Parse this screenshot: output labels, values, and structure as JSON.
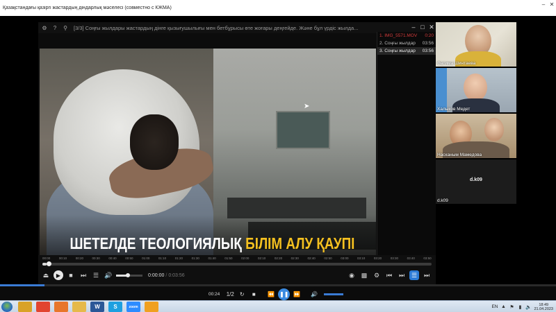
{
  "window": {
    "title": "Қазақстандағы қазіргі жастардың діндарлық мәселесі (совместно с КЖМА)"
  },
  "player": {
    "title": "[3/3] Соңғы жылдары жастардың дінге қызығушылығы мен  бетбұрысы өте жоғары деңгейде. Және бұл үрдіс  жылда...",
    "playlist": [
      {
        "label": "1. IMG_5571.MOV",
        "duration": "0:20",
        "state": "err"
      },
      {
        "label": "2. Соңғы жылдар",
        "duration": "03:56",
        "state": "normal"
      },
      {
        "label": "3. Соңғы жылдар",
        "duration": "03:56",
        "state": "active"
      }
    ],
    "caption": {
      "part1": "ШЕТЕЛДЕ ТЕОЛОГИЯЛЫҚ ",
      "part2": "БІЛІМ АЛУ ҚАУПІ"
    },
    "timeline_ticks": [
      "00:00",
      "00:10",
      "00:20",
      "00:30",
      "00:40",
      "00:50",
      "01:00",
      "01:10",
      "01:20",
      "01:30",
      "01:40",
      "01:50",
      "02:00",
      "02:10",
      "02:20",
      "02:30",
      "02:40",
      "02:50",
      "03:00",
      "03:10",
      "03:20",
      "03:30",
      "03:40",
      "03:50"
    ],
    "progress": 0.01,
    "volume": 0.45,
    "time_current": "0:00:00",
    "time_separator": "/",
    "time_total": "0:03:56"
  },
  "participants": [
    {
      "name": "Фатима Шинтаева"
    },
    {
      "name": "Халыков Медет"
    },
    {
      "name": "Насканым Мамедова"
    },
    {
      "name": "d.k09",
      "center_label": "d.k09"
    }
  ],
  "desktop_player": {
    "time": "00:24",
    "speed": "1/2",
    "progress": 0.08
  },
  "taskbar": {
    "apps": [
      {
        "icon": "explorer-icon",
        "color": "#d9a227"
      },
      {
        "icon": "chrome-icon",
        "color": "#e2442f"
      },
      {
        "icon": "firefox-icon",
        "color": "#e8762b"
      },
      {
        "icon": "folder-icon",
        "color": "#e6b94a"
      },
      {
        "icon": "word-icon",
        "color": "#2b5797",
        "text": "W"
      },
      {
        "icon": "skype-icon",
        "color": "#1ea0e0",
        "text": "S"
      },
      {
        "icon": "zoom-icon",
        "color": "#2d8cff",
        "text": "zoom"
      },
      {
        "icon": "media-player-icon",
        "color": "#f0a020"
      }
    ],
    "lang": "EN",
    "clock_time": "18:49",
    "clock_date": "21.04.2023"
  }
}
